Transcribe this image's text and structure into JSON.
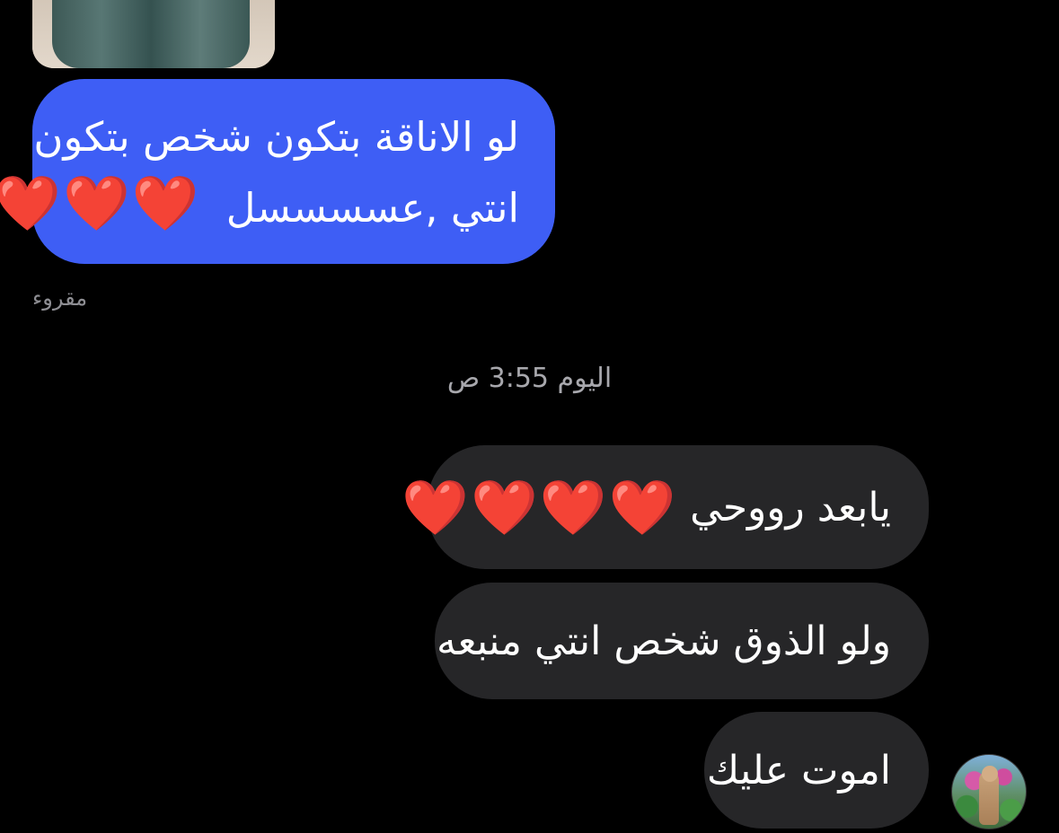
{
  "conversation": {
    "sent_message": {
      "line1": "لو الاناقة بتكون شخص بتكون",
      "line2": "انتي ,عسسسسل",
      "hearts": "❤️❤️❤️"
    },
    "read_receipt": "مقروء",
    "timestamp": "اليوم 3:55 ص",
    "received_messages": [
      {
        "text": "يابعد رووحي",
        "hearts": "❤️❤️❤️❤️"
      },
      {
        "text": "ولو الذوق شخص انتي منبعه"
      },
      {
        "text": "اموت عليك"
      }
    ]
  },
  "colors": {
    "background": "#000000",
    "sent_bubble": "#3e5ef5",
    "received_bubble": "#262628",
    "muted_text": "#8e8e93"
  }
}
